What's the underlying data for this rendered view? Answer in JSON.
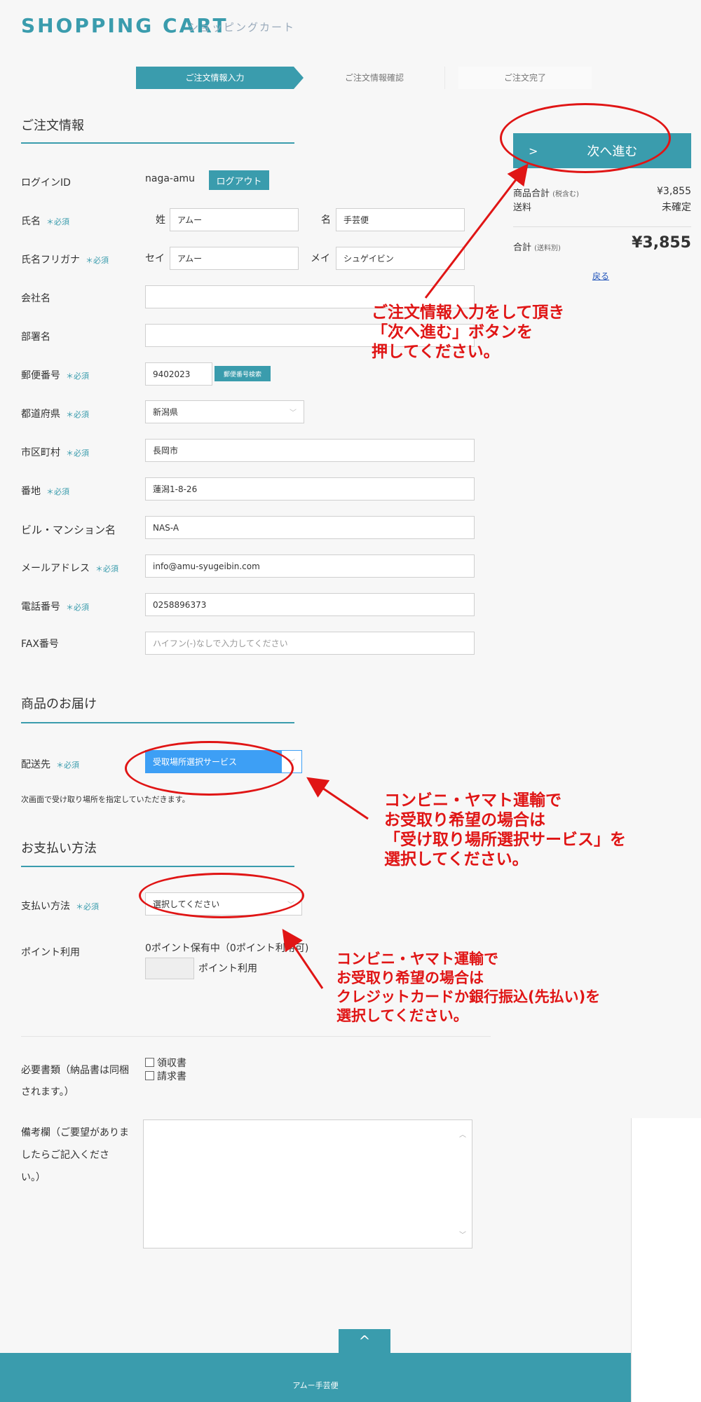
{
  "header": {
    "title": "SHOPPING CART",
    "subtitle": "ショッピングカート"
  },
  "steps": [
    "ご注文情報入力",
    "ご注文情報確認",
    "ご注文完了"
  ],
  "order_section": {
    "title": "ご注文情報",
    "login_label": "ログインID",
    "login_value": "naga-amu",
    "logout_button": "ログアウト",
    "required_mark": "＊必須",
    "name_label": "氏名",
    "sei_label": "姓",
    "sei_value": "アムー",
    "mei_label": "名",
    "mei_value": "手芸便",
    "kana_label": "氏名フリガナ",
    "kana_sei_label": "セイ",
    "kana_sei_value": "アムー",
    "kana_mei_label": "メイ",
    "kana_mei_value": "シュゲイビン",
    "company_label": "会社名",
    "company_value": "",
    "dept_label": "部署名",
    "dept_value": "",
    "zip_label": "郵便番号",
    "zip_value": "9402023",
    "zip_search_button": "郵便番号検索",
    "pref_label": "都道府県",
    "pref_value": "新潟県",
    "city_label": "市区町村",
    "city_value": "長岡市",
    "addr_label": "番地",
    "addr_value": "蓮潟1-8-26",
    "building_label": "ビル・マンション名",
    "building_value": "NAS-A",
    "email_label": "メールアドレス",
    "email_value": "info@amu-syugeibin.com",
    "tel_label": "電話番号",
    "tel_value": "0258896373",
    "fax_label": "FAX番号",
    "fax_placeholder": "ハイフン(-)なしで入力してください"
  },
  "delivery_section": {
    "title": "商品のお届け",
    "dest_label": "配送先",
    "dest_value": "受取場所選択サービス",
    "note": "次画面で受け取り場所を指定していただきます。"
  },
  "payment_section": {
    "title": "お支払い方法",
    "method_label": "支払い方法",
    "method_value": "選択してください",
    "points_label": "ポイント利用",
    "points_info": "0ポイント保有中（0ポイント利用可)",
    "points_unit": "ポイント利用"
  },
  "docs": {
    "label_line1": "必要書類（納品書は同梱",
    "label_line2": "されます。）",
    "option1": "領収書",
    "option2": "請求書"
  },
  "remarks": {
    "label_line1": "備考欄（ご要望がありま",
    "label_line2": "したらご記入くださ",
    "label_line3": "い。）",
    "value": ""
  },
  "sidebar": {
    "next_button": "次へ進む",
    "next_chevron": ">",
    "subtotal_label": "商品合計",
    "subtotal_note": "(税含む)",
    "subtotal_value": "¥3,855",
    "shipping_label": "送料",
    "shipping_value": "未確定",
    "total_label": "合計",
    "total_note": "(送料別)",
    "total_value": "¥3,855",
    "back_link": "戻る"
  },
  "annotations": {
    "a1_line1": "ご注文情報入力をして頂き",
    "a1_line2": "「次へ進む」ボタンを",
    "a1_line3": "押してください。",
    "a2_line1": "コンビニ・ヤマト運輸で",
    "a2_line2": "お受取り希望の場合は",
    "a2_line3": "「受け取り場所選択サービス」を",
    "a2_line4": "選択してください。",
    "a3_line1": "コンビニ・ヤマト運輸で",
    "a3_line2": "お受取り希望の場合は",
    "a3_line3": "クレジットカードか銀行振込(先払い)を",
    "a3_line4": "選択してください。"
  },
  "footer": {
    "top_icon": "^",
    "text": "アムー手芸便"
  },
  "colors": {
    "accent": "#3a9cad",
    "annotation": "#e01515",
    "background": "#f7f7f7"
  }
}
